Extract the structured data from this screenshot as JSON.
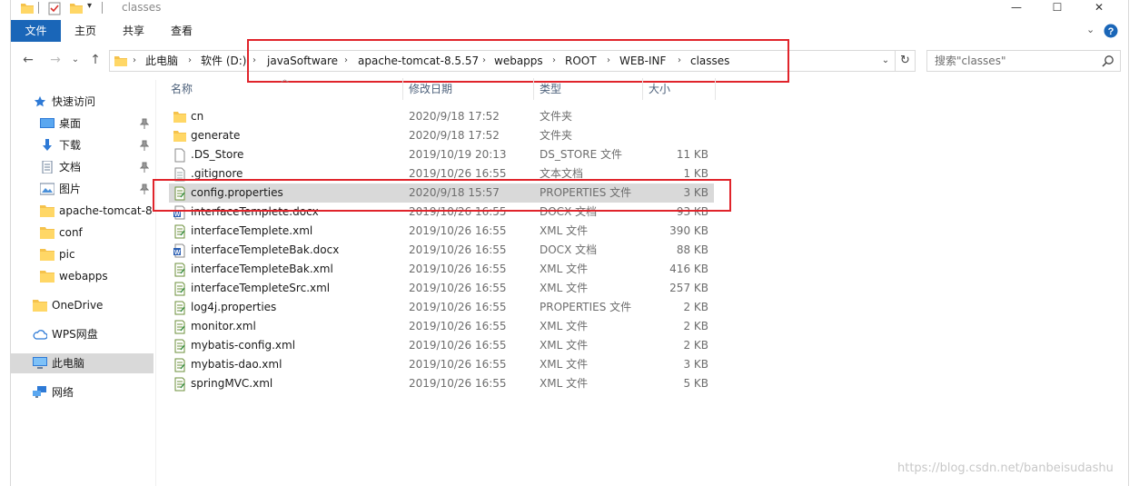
{
  "window": {
    "title": "classes"
  },
  "ribbon": {
    "tabs": [
      "文件",
      "主页",
      "共享",
      "查看"
    ]
  },
  "address": {
    "crumbs": [
      "此电脑",
      "软件 (D:)",
      "javaSoftware",
      "apache-tomcat-8.5.57",
      "webapps",
      "ROOT",
      "WEB-INF",
      "classes"
    ],
    "search_placeholder": "搜索\"classes\""
  },
  "sidebar": {
    "items": [
      {
        "label": "快速访问",
        "icon": "star-icon"
      },
      {
        "label": "桌面",
        "icon": "desktop-icon",
        "pinned": true
      },
      {
        "label": "下载",
        "icon": "download-icon",
        "pinned": true
      },
      {
        "label": "文档",
        "icon": "document-icon",
        "pinned": true
      },
      {
        "label": "图片",
        "icon": "picture-icon",
        "pinned": true
      },
      {
        "label": "apache-tomcat-8.",
        "icon": "folder-icon"
      },
      {
        "label": "conf",
        "icon": "folder-icon"
      },
      {
        "label": "pic",
        "icon": "folder-icon"
      },
      {
        "label": "webapps",
        "icon": "folder-icon"
      },
      {
        "label": "OneDrive",
        "icon": "folder-icon"
      },
      {
        "label": "WPS网盘",
        "icon": "cloud-icon"
      },
      {
        "label": "此电脑",
        "icon": "computer-icon",
        "selected": true
      },
      {
        "label": "网络",
        "icon": "network-icon"
      }
    ]
  },
  "file_list": {
    "headers": [
      "名称",
      "修改日期",
      "类型",
      "大小"
    ],
    "rows": [
      {
        "name": "cn",
        "date": "2020/9/18 17:52",
        "type": "文件夹",
        "size": "",
        "icon": "folder-icon"
      },
      {
        "name": "generate",
        "date": "2020/9/18 17:52",
        "type": "文件夹",
        "size": "",
        "icon": "folder-icon"
      },
      {
        "name": ".DS_Store",
        "date": "2019/10/19 20:13",
        "type": "DS_STORE 文件",
        "size": "11 KB",
        "icon": "file-icon"
      },
      {
        "name": ".gitignore",
        "date": "2019/10/26 16:55",
        "type": "文本文档",
        "size": "1 KB",
        "icon": "text-file-icon"
      },
      {
        "name": "config.properties",
        "date": "2020/9/18 15:57",
        "type": "PROPERTIES 文件",
        "size": "3 KB",
        "icon": "properties-file-icon",
        "selected": true
      },
      {
        "name": "interfaceTemplete.docx",
        "date": "2019/10/26 16:55",
        "type": "DOCX 文档",
        "size": "93 KB",
        "icon": "word-file-icon"
      },
      {
        "name": "interfaceTemplete.xml",
        "date": "2019/10/26 16:55",
        "type": "XML 文件",
        "size": "390 KB",
        "icon": "xml-file-icon"
      },
      {
        "name": "interfaceTempleteBak.docx",
        "date": "2019/10/26 16:55",
        "type": "DOCX 文档",
        "size": "88 KB",
        "icon": "word-file-icon"
      },
      {
        "name": "interfaceTempleteBak.xml",
        "date": "2019/10/26 16:55",
        "type": "XML 文件",
        "size": "416 KB",
        "icon": "xml-file-icon"
      },
      {
        "name": "interfaceTempleteSrc.xml",
        "date": "2019/10/26 16:55",
        "type": "XML 文件",
        "size": "257 KB",
        "icon": "xml-file-icon"
      },
      {
        "name": "log4j.properties",
        "date": "2019/10/26 16:55",
        "type": "PROPERTIES 文件",
        "size": "2 KB",
        "icon": "properties-file-icon"
      },
      {
        "name": "monitor.xml",
        "date": "2019/10/26 16:55",
        "type": "XML 文件",
        "size": "2 KB",
        "icon": "xml-file-icon"
      },
      {
        "name": "mybatis-config.xml",
        "date": "2019/10/26 16:55",
        "type": "XML 文件",
        "size": "2 KB",
        "icon": "xml-file-icon"
      },
      {
        "name": "mybatis-dao.xml",
        "date": "2019/10/26 16:55",
        "type": "XML 文件",
        "size": "3 KB",
        "icon": "xml-file-icon"
      },
      {
        "name": "springMVC.xml",
        "date": "2019/10/26 16:55",
        "type": "XML 文件",
        "size": "5 KB",
        "icon": "xml-file-icon"
      }
    ]
  },
  "watermark": "https://blog.csdn.net/banbeisudashu",
  "colors": {
    "accent": "#1a66b8",
    "highlight": "#e0242b",
    "selection": "#d9d9d9"
  }
}
